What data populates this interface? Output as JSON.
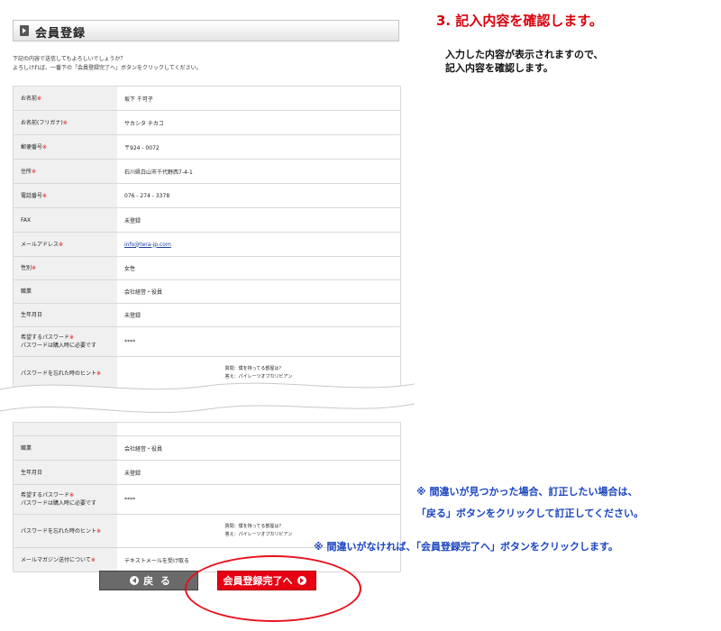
{
  "header": {
    "title": "会員登録"
  },
  "intro": {
    "line1": "下記の内容で送信してもよろしいでしょうか？",
    "line2": "よろしければ、一番下の「会員登録完了へ」ボタンをクリックしてください。"
  },
  "req_mark": "※",
  "form": {
    "rows": [
      {
        "label": "お名前",
        "value": "坂下 千可子",
        "required": true
      },
      {
        "label": "お名前(フリガナ)",
        "value": "サカシタ チカコ",
        "required": true
      },
      {
        "label": "郵便番号",
        "value": "〒924 - 0072",
        "required": true
      },
      {
        "label": "住所",
        "value": "石川県白山市千代野西7-4-1",
        "required": true
      },
      {
        "label": "電話番号",
        "value": "076 - 274 - 3378",
        "required": true
      },
      {
        "label": "FAX",
        "value": "未登録",
        "required": false
      },
      {
        "label": "メールアドレス",
        "value": "info@tera-jp.com",
        "required": true
      },
      {
        "label": "性別",
        "value": "女性",
        "required": true
      },
      {
        "label": "職業",
        "value": "会社経営・役員",
        "required": false
      },
      {
        "label": "生年月日",
        "value": "未登録",
        "required": false
      }
    ],
    "password": {
      "label": "希望するパスワード",
      "sublabel": "パスワードは購入時に必要です",
      "value": "****"
    },
    "hint": {
      "label": "パスワードを忘れた時のヒント",
      "question": "質問：僕を持ってる部屋は？",
      "answer": "答え：パイレーツオブカリビアン"
    }
  },
  "form2": {
    "rows": [
      {
        "label": "職業",
        "value": "会社経営・役員"
      },
      {
        "label": "生年月日",
        "value": "未登録"
      }
    ],
    "password": {
      "label": "希望するパスワード",
      "sublabel": "パスワードは購入時に必要です",
      "value": "****"
    },
    "hint": {
      "label": "パスワードを忘れた時のヒント",
      "question": "質問：僕を持ってる部屋は？",
      "answer": "答え：パイレーツオブカリビアン"
    },
    "magazine": {
      "label": "メールマガジン送付について",
      "value": "テキストメールを受け取る"
    }
  },
  "step": {
    "title": "3. 記入内容を確認します。",
    "desc_line1": "入力した内容が表示されますので、",
    "desc_line2": "記入内容を確認します。"
  },
  "notes": {
    "error1": "※ 間違いが見つかった場合、訂正したい場合は、",
    "error2": "「戻る」ボタンをクリックして訂正してください。",
    "ok": "※ 間違いがなければ、「会員登録完了へ」ボタンをクリックします。"
  },
  "buttons": {
    "back": "戻 る",
    "complete": "会員登録完了へ"
  },
  "colors": {
    "accent": "#e60012",
    "note": "#1a44c0",
    "label_bg": "#f0f0f0"
  }
}
